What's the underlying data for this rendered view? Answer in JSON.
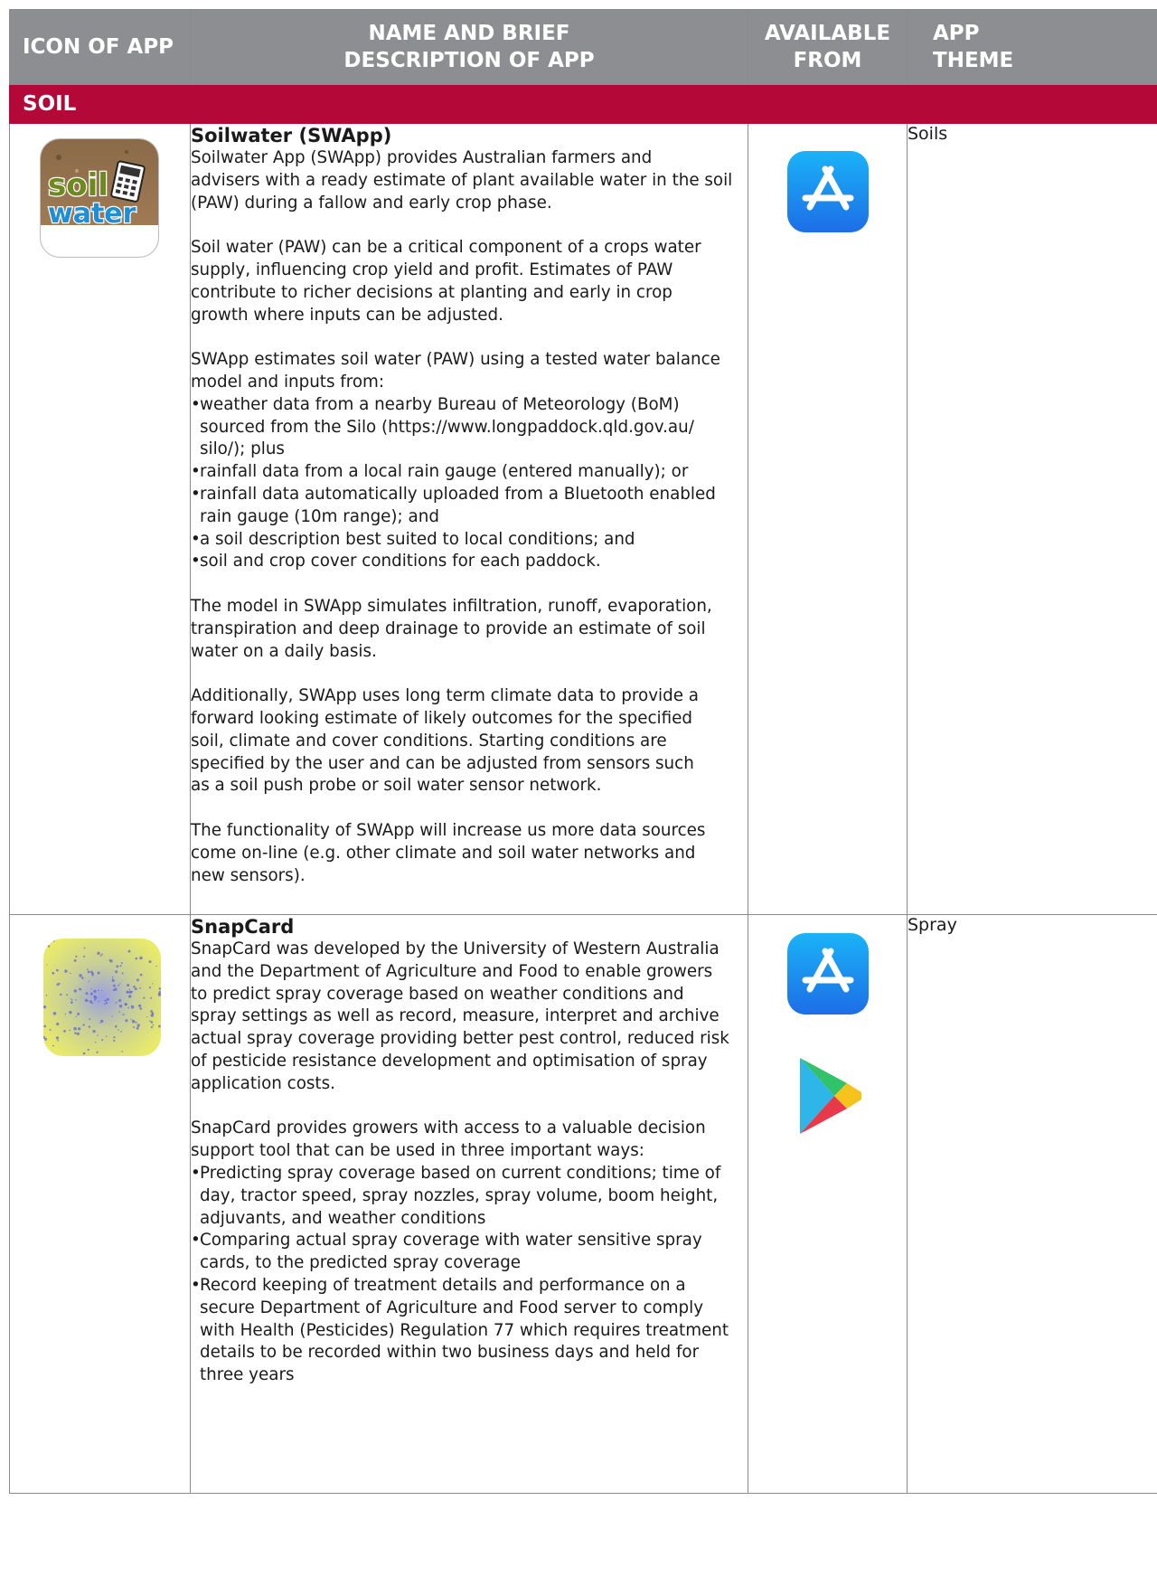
{
  "table": {
    "headers": {
      "icon": "ICON OF APP",
      "name": "NAME AND BRIEF\nDESCRIPTION OF APP",
      "available": "AVAILABLE\nFROM",
      "theme": "APP\nTHEME"
    },
    "section": "SOIL",
    "colors": {
      "header_bg": "#8c8e91",
      "section_bg": "#b30838",
      "app_store_blue": "#1f8bf0"
    },
    "apps": [
      {
        "icon": "soilwater-app-icon",
        "icon_text": {
          "line1": "soil",
          "line2": "water"
        },
        "title": "Soilwater (SWApp)",
        "paragraphs": [
          "Soilwater App (SWApp) provides Australian farmers and\nadvisers with a ready estimate of plant available water in the soil\n(PAW) during a fallow and early crop phase.",
          "Soil water (PAW) can be a critical component of a crops water\nsupply, influencing crop yield and profit. Estimates of PAW\ncontribute to richer decisions at planting and early in crop\ngrowth where inputs can be adjusted.",
          "SWApp estimates soil water (PAW) using a tested water balance\nmodel and inputs from:"
        ],
        "bullets": [
          "weather data from a nearby Bureau of Meteorology (BoM)\nsourced from the Silo (https://www.longpaddock.qld.gov.au/\nsilo/); plus",
          "rainfall data from a local rain gauge (entered manually); or",
          "rainfall data automatically uploaded from a Bluetooth enabled\nrain gauge (10m range); and",
          "a soil description best suited to local conditions; and",
          "soil and crop cover conditions for each paddock."
        ],
        "paragraphs_after": [
          "The model in SWApp simulates infiltration, runoff, evaporation,\ntranspiration and deep drainage to provide an estimate of soil\nwater on a daily basis.",
          "Additionally, SWApp uses long term climate data to provide a\nforward looking estimate of likely outcomes for the specified\nsoil, climate and cover conditions. Starting conditions are\nspecified by the user and can be adjusted from sensors such\nas a soil push probe or soil water sensor network.",
          "The functionality of SWApp will increase us more data sources\ncome on-line (e.g. other climate and soil water networks and\nnew sensors)."
        ],
        "available_from": [
          "app-store-icon"
        ],
        "theme": "Soils"
      },
      {
        "icon": "snapcard-app-icon",
        "title": "SnapCard",
        "paragraphs": [
          "SnapCard was developed by the University of Western Australia\nand the Department of Agriculture and Food to enable growers\nto predict spray coverage based on weather conditions and\nspray settings as well as record, measure, interpret and archive\nactual spray coverage providing better pest control, reduced risk\nof pesticide resistance development and optimisation of spray\napplication costs.",
          "SnapCard provides growers with access to a valuable decision\nsupport tool that can be used in three important ways:"
        ],
        "bullets": [
          "Predicting spray coverage based on current conditions; time of\nday, tractor speed, spray nozzles, spray volume, boom height,\nadjuvants, and weather conditions",
          "Comparing actual spray coverage with water sensitive spray\ncards, to the predicted spray coverage",
          "Record keeping of treatment details and performance on a\nsecure Department of Agriculture and Food server to comply\nwith Health (Pesticides) Regulation 77 which requires treatment\ndetails to be recorded within two business days and held for\nthree years"
        ],
        "available_from": [
          "app-store-icon",
          "google-play-icon"
        ],
        "theme": "Spray"
      }
    ]
  }
}
